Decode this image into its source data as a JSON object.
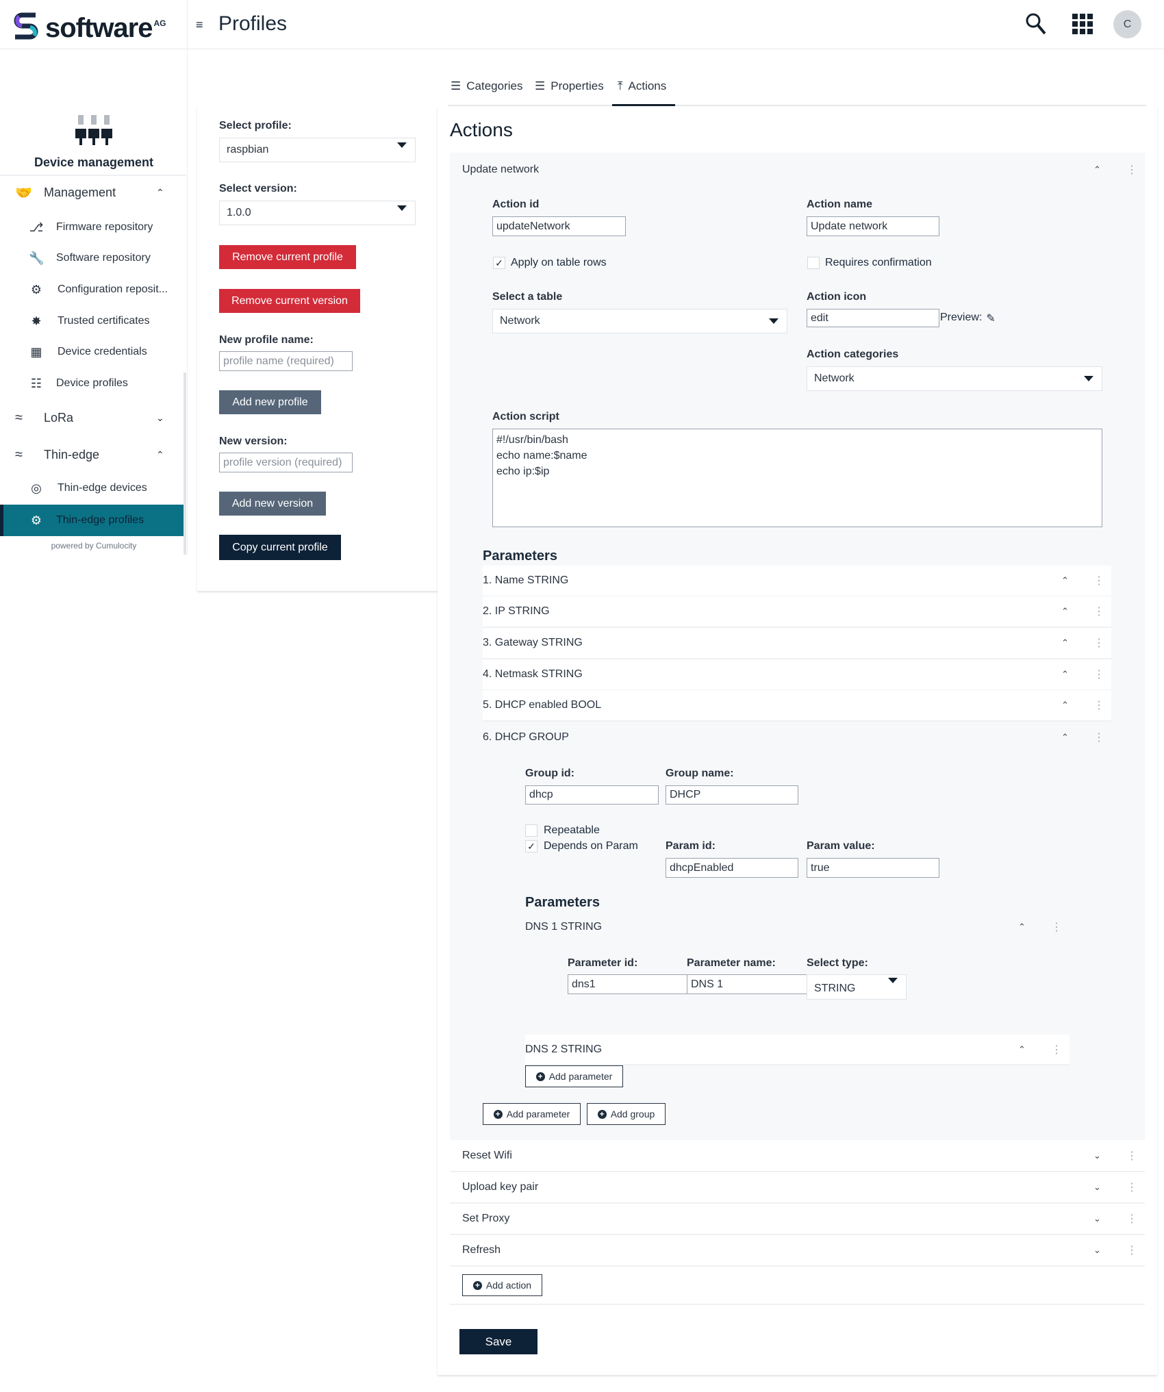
{
  "header": {
    "brand": "software",
    "brand_suffix": "AG",
    "title": "Profiles",
    "avatar_initial": "C"
  },
  "sidebar": {
    "app_title": "Device management",
    "groups": [
      {
        "label": "Management",
        "expanded": true,
        "items": [
          {
            "label": "Firmware repository",
            "icon": "firmware-icon"
          },
          {
            "label": "Software repository",
            "icon": "software-icon"
          },
          {
            "label": "Configuration reposit...",
            "icon": "configuration-icon"
          },
          {
            "label": "Trusted certificates",
            "icon": "certificate-icon"
          },
          {
            "label": "Device credentials",
            "icon": "credentials-icon"
          },
          {
            "label": "Device profiles",
            "icon": "device-profiles-icon"
          }
        ]
      },
      {
        "label": "LoRa",
        "expanded": false,
        "items": []
      },
      {
        "label": "Thin-edge",
        "expanded": true,
        "items": [
          {
            "label": "Thin-edge devices",
            "icon": "thin-edge-devices-icon"
          },
          {
            "label": "Thin-edge profiles",
            "icon": "gear-icon",
            "active": true
          }
        ]
      }
    ],
    "footer": "powered by Cumulocity",
    "active_color": "#0b7285"
  },
  "profile_panel": {
    "select_profile_label": "Select profile:",
    "select_profile_value": "raspbian",
    "select_version_label": "Select version:",
    "select_version_value": "1.0.0",
    "remove_profile": "Remove current profile",
    "remove_version": "Remove current version",
    "new_profile_label": "New profile name:",
    "new_profile_placeholder": "profile name (required)",
    "add_profile": "Add new profile",
    "new_version_label": "New version:",
    "new_version_placeholder": "profile version (required)",
    "add_version": "Add new version",
    "copy_profile": "Copy current profile"
  },
  "tabs": [
    {
      "label": "Categories",
      "icon": "list-icon"
    },
    {
      "label": "Properties",
      "icon": "list-icon"
    },
    {
      "label": "Actions",
      "icon": "upload-icon",
      "active": true
    }
  ],
  "actions": {
    "heading": "Actions",
    "expanded": {
      "title": "Update network",
      "action_id_label": "Action id",
      "action_id": "updateNetwork",
      "action_name_label": "Action name",
      "action_name": "Update network",
      "apply_rows_label": "Apply on table rows",
      "apply_rows": true,
      "requires_confirm_label": "Requires confirmation",
      "requires_confirm": false,
      "table_label": "Select a table",
      "table_value": "Network",
      "icon_label": "Action icon",
      "icon_value": "edit",
      "preview_label": "Preview:",
      "categories_label": "Action categories",
      "categories_value": "Network",
      "script_label": "Action script",
      "script": "#!/usr/bin/bash\necho name:$name\necho ip:$ip",
      "parameters_heading": "Parameters",
      "parameters": [
        "1. Name STRING",
        "2. IP STRING",
        "3. Gateway STRING",
        "4. Netmask STRING",
        "5. DHCP enabled BOOL",
        "6. DHCP GROUP"
      ],
      "group": {
        "group_id_label": "Group id:",
        "group_id": "dhcp",
        "group_name_label": "Group name:",
        "group_name": "DHCP",
        "repeatable_label": "Repeatable",
        "repeatable": false,
        "depends_label": "Depends on Param",
        "depends": true,
        "param_id_label": "Param id:",
        "param_id": "dhcpEnabled",
        "param_value_label": "Param value:",
        "param_value": "true",
        "parameters_heading": "Parameters",
        "dns1_title": "DNS 1 STRING",
        "parameter_id_label": "Parameter id:",
        "parameter_id": "dns1",
        "parameter_name_label": "Parameter name:",
        "parameter_name": "DNS 1",
        "type_label": "Select type:",
        "type_value": "STRING",
        "dns2_title": "DNS 2 STRING",
        "add_parameter": "Add parameter"
      },
      "add_parameter": "Add parameter",
      "add_group": "Add group"
    },
    "collapsed": [
      "Reset Wifi",
      "Upload key pair",
      "Set Proxy",
      "Refresh"
    ],
    "add_action": "Add action",
    "save": "Save"
  }
}
